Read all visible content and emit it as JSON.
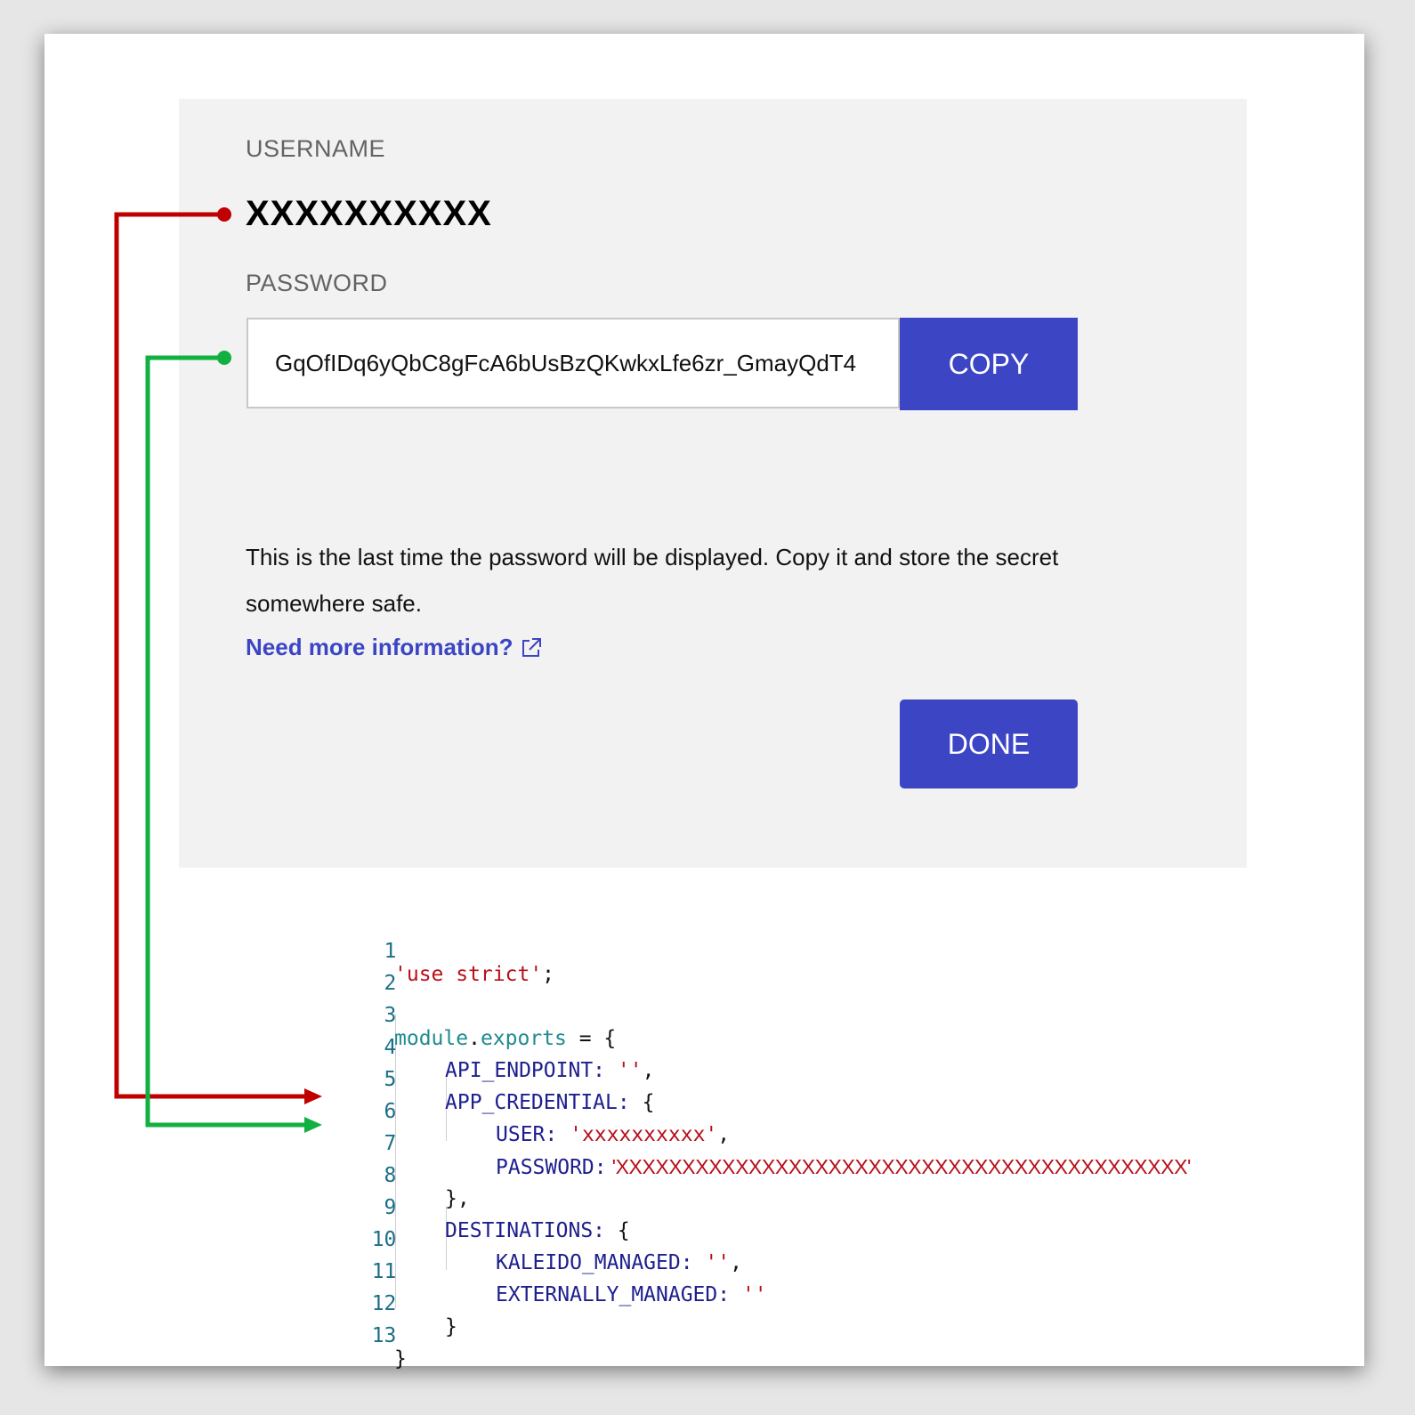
{
  "dialog": {
    "username_label": "USERNAME",
    "username_value": "XXXXXXXXXX",
    "password_label": "PASSWORD",
    "password_value": "GqOfIDq6yQbC8gFcA6bUsBzQKwkxLfe6zr_GmayQdT4",
    "copy_label": "COPY",
    "notice": "This is the last time the password will be displayed. Copy it and store the secret somewhere safe.",
    "info_link": "Need more information?",
    "done_label": "DONE"
  },
  "code": {
    "line_numbers": [
      "1",
      "2",
      "3",
      "4",
      "5",
      "6",
      "7",
      "8",
      "9",
      "10",
      "11",
      "12",
      "13"
    ],
    "l1_str": "'use strict'",
    "l1_p": ";",
    "l3_a": "module",
    "l3_dot": ".",
    "l3_b": "exports",
    "l3_p": " = {",
    "l4_k": "API_ENDPOINT:",
    "l4_s": " ''",
    "l4_p": ",",
    "l5_k": "APP_CREDENTIAL:",
    "l5_p": " {",
    "l6_k": "USER:",
    "l6_s": " 'xxxxxxxxxx'",
    "l6_p": ",",
    "l7_k": "PASSWORD:",
    "l7_s": " 'XXXXXXXXXXXXXXXXXXXXXXXXXXXXXXXXXXXXXXXXXXX'",
    "l8_p": "},",
    "l9_k": "DESTINATIONS:",
    "l9_p": " {",
    "l10_k": "KALEIDO_MANAGED:",
    "l10_s": " ''",
    "l10_p": ",",
    "l11_k": "EXTERNALLY_MANAGED:",
    "l11_s": " ''",
    "l12_p": "}",
    "l13_p": "}"
  },
  "colors": {
    "accent": "#3c45c4",
    "user_arrow": "#c00000",
    "password_arrow": "#12b040"
  },
  "icons": {
    "external_link": "external-link-icon"
  }
}
